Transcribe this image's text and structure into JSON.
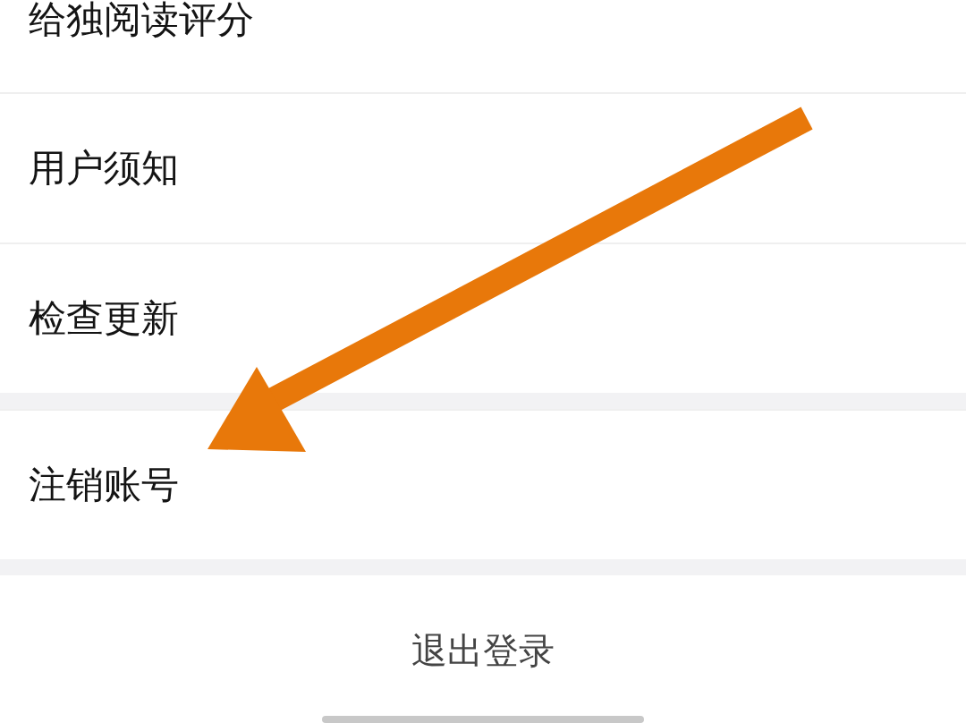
{
  "settings_groups": [
    {
      "items": [
        "给独阅读评分",
        "用户须知",
        "检查更新"
      ]
    },
    {
      "items": [
        "注销账号"
      ]
    }
  ],
  "logout_button": "退出登录"
}
